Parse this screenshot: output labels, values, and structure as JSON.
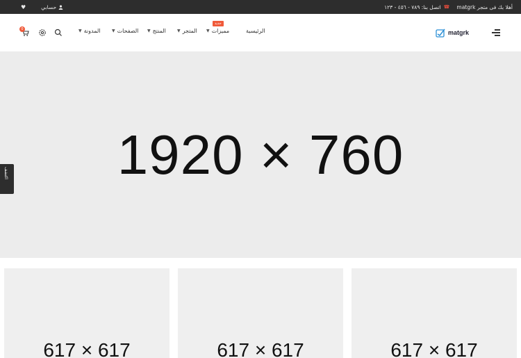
{
  "topbar": {
    "welcome": "أهلا بك فى متجر matgrk",
    "phone": "اتصل بنا: ٧٨٩ - ٤٥٦ - ١٢٣",
    "account": "حسابي"
  },
  "header": {
    "logo": "matgrk",
    "nav": [
      {
        "label": "الرئيسية"
      },
      {
        "label": "مميزات",
        "badge": "جديد"
      },
      {
        "label": "المتجر"
      },
      {
        "label": "المنتج"
      },
      {
        "label": "الصفحات"
      },
      {
        "label": "المدونة"
      }
    ],
    "cart_count": "0"
  },
  "hero": {
    "label": "1920 × 760"
  },
  "sidetab": {
    "label": "اكتشف"
  },
  "cards": [
    {
      "label": "617 × 617"
    },
    {
      "label": "617 × 617"
    },
    {
      "label": "617 × 617"
    }
  ],
  "colors": {
    "accent": "#f05a3a",
    "topbar_bg": "#2d2d2d",
    "placeholder_bg": "#ececec"
  }
}
